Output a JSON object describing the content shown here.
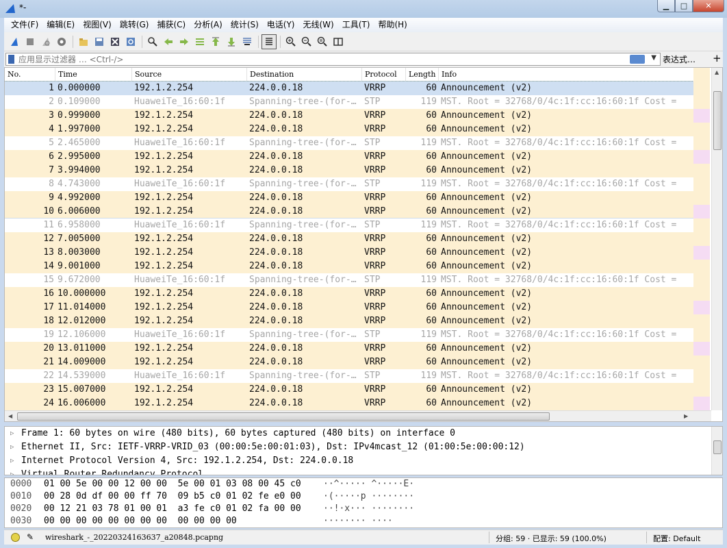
{
  "window": {
    "title": "*-"
  },
  "menu": [
    "文件(F)",
    "编辑(E)",
    "视图(V)",
    "跳转(G)",
    "捕获(C)",
    "分析(A)",
    "统计(S)",
    "电话(Y)",
    "无线(W)",
    "工具(T)",
    "帮助(H)"
  ],
  "toolbar": {
    "icons": [
      "start-capture-icon",
      "stop-capture-icon",
      "restart-capture-icon",
      "capture-options-icon",
      "open-file-icon",
      "save-file-icon",
      "close-file-icon",
      "reload-file-icon",
      "find-packet-icon",
      "go-back-icon",
      "go-forward-icon",
      "go-to-packet-icon",
      "go-first-icon",
      "go-last-icon",
      "autoscroll-icon",
      "colorize-icon",
      "zoom-in-icon",
      "zoom-out-icon",
      "zoom-normal-icon",
      "resize-columns-icon"
    ]
  },
  "filter": {
    "placeholder": "应用显示过滤器 … <Ctrl-/>",
    "expression_label": "表达式…",
    "add_label": "+"
  },
  "columns": [
    "No.",
    "Time",
    "Source",
    "Destination",
    "Protocol",
    "Length",
    "Info"
  ],
  "packets": [
    {
      "no": "1",
      "time": "0.000000",
      "src": "192.1.2.254",
      "dst": "224.0.0.18",
      "proto": "VRRP",
      "len": "60",
      "info": "Announcement (v2)",
      "selected": true
    },
    {
      "no": "2",
      "time": "0.109000",
      "src": "HuaweiTe_16:60:1f",
      "dst": "Spanning-tree-(for-…",
      "proto": "STP",
      "len": "119",
      "info": "MST. Root = 32768/0/4c:1f:cc:16:60:1f  Cost ="
    },
    {
      "no": "3",
      "time": "0.999000",
      "src": "192.1.2.254",
      "dst": "224.0.0.18",
      "proto": "VRRP",
      "len": "60",
      "info": "Announcement (v2)"
    },
    {
      "no": "4",
      "time": "1.997000",
      "src": "192.1.2.254",
      "dst": "224.0.0.18",
      "proto": "VRRP",
      "len": "60",
      "info": "Announcement (v2)"
    },
    {
      "no": "5",
      "time": "2.465000",
      "src": "HuaweiTe_16:60:1f",
      "dst": "Spanning-tree-(for-…",
      "proto": "STP",
      "len": "119",
      "info": "MST. Root = 32768/0/4c:1f:cc:16:60:1f  Cost ="
    },
    {
      "no": "6",
      "time": "2.995000",
      "src": "192.1.2.254",
      "dst": "224.0.0.18",
      "proto": "VRRP",
      "len": "60",
      "info": "Announcement (v2)"
    },
    {
      "no": "7",
      "time": "3.994000",
      "src": "192.1.2.254",
      "dst": "224.0.0.18",
      "proto": "VRRP",
      "len": "60",
      "info": "Announcement (v2)"
    },
    {
      "no": "8",
      "time": "4.743000",
      "src": "HuaweiTe_16:60:1f",
      "dst": "Spanning-tree-(for-…",
      "proto": "STP",
      "len": "119",
      "info": "MST. Root = 32768/0/4c:1f:cc:16:60:1f  Cost ="
    },
    {
      "no": "9",
      "time": "4.992000",
      "src": "192.1.2.254",
      "dst": "224.0.0.18",
      "proto": "VRRP",
      "len": "60",
      "info": "Announcement (v2)"
    },
    {
      "no": "10",
      "time": "6.006000",
      "src": "192.1.2.254",
      "dst": "224.0.0.18",
      "proto": "VRRP",
      "len": "60",
      "info": "Announcement (v2)"
    },
    {
      "no": "11",
      "time": "6.958000",
      "src": "HuaweiTe_16:60:1f",
      "dst": "Spanning-tree-(for-…",
      "proto": "STP",
      "len": "119",
      "info": "MST. Root = 32768/0/4c:1f:cc:16:60:1f  Cost =",
      "highlight": true
    },
    {
      "no": "12",
      "time": "7.005000",
      "src": "192.1.2.254",
      "dst": "224.0.0.18",
      "proto": "VRRP",
      "len": "60",
      "info": "Announcement (v2)"
    },
    {
      "no": "13",
      "time": "8.003000",
      "src": "192.1.2.254",
      "dst": "224.0.0.18",
      "proto": "VRRP",
      "len": "60",
      "info": "Announcement (v2)"
    },
    {
      "no": "14",
      "time": "9.001000",
      "src": "192.1.2.254",
      "dst": "224.0.0.18",
      "proto": "VRRP",
      "len": "60",
      "info": "Announcement (v2)"
    },
    {
      "no": "15",
      "time": "9.672000",
      "src": "HuaweiTe_16:60:1f",
      "dst": "Spanning-tree-(for-…",
      "proto": "STP",
      "len": "119",
      "info": "MST. Root = 32768/0/4c:1f:cc:16:60:1f  Cost ="
    },
    {
      "no": "16",
      "time": "10.000000",
      "src": "192.1.2.254",
      "dst": "224.0.0.18",
      "proto": "VRRP",
      "len": "60",
      "info": "Announcement (v2)"
    },
    {
      "no": "17",
      "time": "11.014000",
      "src": "192.1.2.254",
      "dst": "224.0.0.18",
      "proto": "VRRP",
      "len": "60",
      "info": "Announcement (v2)"
    },
    {
      "no": "18",
      "time": "12.012000",
      "src": "192.1.2.254",
      "dst": "224.0.0.18",
      "proto": "VRRP",
      "len": "60",
      "info": "Announcement (v2)"
    },
    {
      "no": "19",
      "time": "12.106000",
      "src": "HuaweiTe_16:60:1f",
      "dst": "Spanning-tree-(for-…",
      "proto": "STP",
      "len": "119",
      "info": "MST. Root = 32768/0/4c:1f:cc:16:60:1f  Cost ="
    },
    {
      "no": "20",
      "time": "13.011000",
      "src": "192.1.2.254",
      "dst": "224.0.0.18",
      "proto": "VRRP",
      "len": "60",
      "info": "Announcement (v2)"
    },
    {
      "no": "21",
      "time": "14.009000",
      "src": "192.1.2.254",
      "dst": "224.0.0.18",
      "proto": "VRRP",
      "len": "60",
      "info": "Announcement (v2)"
    },
    {
      "no": "22",
      "time": "14.539000",
      "src": "HuaweiTe_16:60:1f",
      "dst": "Spanning-tree-(for-…",
      "proto": "STP",
      "len": "119",
      "info": "MST. Root = 32768/0/4c:1f:cc:16:60:1f  Cost ="
    },
    {
      "no": "23",
      "time": "15.007000",
      "src": "192.1.2.254",
      "dst": "224.0.0.18",
      "proto": "VRRP",
      "len": "60",
      "info": "Announcement (v2)"
    },
    {
      "no": "24",
      "time": "16.006000",
      "src": "192.1.2.254",
      "dst": "224.0.0.18",
      "proto": "VRRP",
      "len": "60",
      "info": "Announcement (v2)"
    }
  ],
  "details": [
    "Frame 1: 60 bytes on wire (480 bits), 60 bytes captured (480 bits) on interface 0",
    "Ethernet II, Src: IETF-VRRP-VRID_03 (00:00:5e:00:01:03), Dst: IPv4mcast_12 (01:00:5e:00:00:12)",
    "Internet Protocol Version 4, Src: 192.1.2.254, Dst: 224.0.0.18",
    "Virtual Router Redundancy Protocol"
  ],
  "bytes": [
    {
      "offset": "0000",
      "hex": "01 00 5e 00 00 12 00 00  5e 00 01 03 08 00 45 c0",
      "ascii": "··^····· ^·····E·"
    },
    {
      "offset": "0010",
      "hex": "00 28 0d df 00 00 ff 70  09 b5 c0 01 02 fe e0 00",
      "ascii": "·(·····p ········"
    },
    {
      "offset": "0020",
      "hex": "00 12 21 03 78 01 00 01  a3 fe c0 01 02 fa 00 00",
      "ascii": "··!·x··· ········"
    },
    {
      "offset": "0030",
      "hex": "00 00 00 00 00 00 00 00  00 00 00 00",
      "ascii": "········ ····"
    }
  ],
  "status": {
    "file": "wireshark_-_20220324163637_a20848.pcapng",
    "packets": "分组: 59 · 已显示: 59 (100.0%)",
    "profile": "配置: Default"
  },
  "colors": {
    "vrrp_row": "#fdf0d2",
    "stp_row": "#ffffff",
    "selected_row": "#cfdff2",
    "stp_text": "#a6a6a6"
  }
}
